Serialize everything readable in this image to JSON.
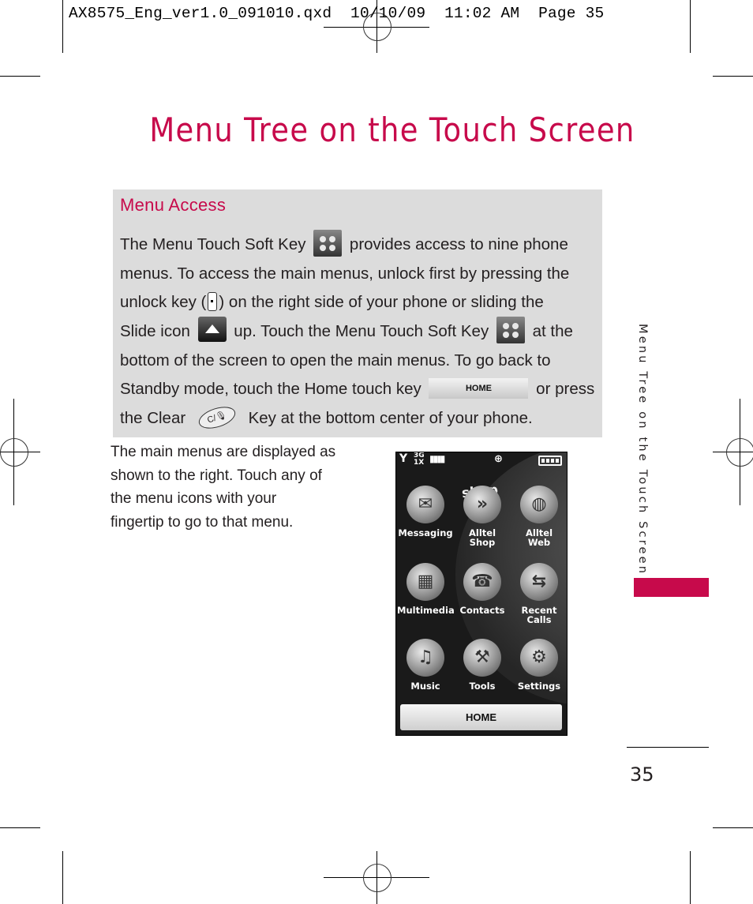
{
  "slug_line": "AX8575_Eng_ver1.0_091010.qxd  10/10/09  11:02 AM  Page 35",
  "page_title": "Menu Tree on the Touch Screen",
  "menu_access": {
    "heading": "Menu Access",
    "lines": [
      {
        "before": "The Menu Touch Soft Key",
        "icon": "menu-soft-key-icon",
        "after": " provides access to nine phone"
      },
      {
        "before": "menus. To access the main menus, unlock first by pressing the",
        "icon": null,
        "after": ""
      },
      {
        "before": "unlock key (",
        "icon": "unlock-key-icon",
        "after": ") on the right side of your phone or sliding the"
      },
      {
        "before": "Slide icon",
        "icon": "slide-icon",
        "after": "up. Touch the Menu Touch Soft Key"
      },
      {
        "before": "bottom of the screen to open the main menus. To go back to",
        "icon": null,
        "after": ""
      },
      {
        "before": "Standby mode, touch the Home touch key",
        "icon": "home-key-icon",
        "after": "or press"
      },
      {
        "before": "the Clear",
        "icon": "clear-key-icon",
        "after": "Key at the bottom center of your phone."
      }
    ],
    "line4_tail": "at the",
    "home_key_label": "HOME",
    "clear_key_label": "C/🎙"
  },
  "side_text": [
    "The main menus are displayed as",
    "shown to the right. Touch any of",
    "the menu icons with your",
    "fingertip to go to that menu."
  ],
  "phone_screen": {
    "status": {
      "signal": "Y",
      "network_top": "3G",
      "network_bottom": "1X",
      "bars": "▮▮▮▮",
      "center_icon": "⊕"
    },
    "shop_banner": "shop",
    "apps": [
      {
        "label": "Messaging",
        "icon": "envelope-icon",
        "glyph": "✉"
      },
      {
        "label": "Alltel\nShop",
        "icon": "shop-arrow-icon",
        "glyph": "»"
      },
      {
        "label": "Alltel\nWeb",
        "icon": "globe-icon",
        "glyph": "◍"
      },
      {
        "label": "Multimedia",
        "icon": "clapperboard-icon",
        "glyph": "▦"
      },
      {
        "label": "Contacts",
        "icon": "contacts-book-icon",
        "glyph": "☎"
      },
      {
        "label": "Recent\nCalls",
        "icon": "recent-calls-icon",
        "glyph": "⇆"
      },
      {
        "label": "Music",
        "icon": "music-note-icon",
        "glyph": "♫"
      },
      {
        "label": "Tools",
        "icon": "toolbox-icon",
        "glyph": "⚒"
      },
      {
        "label": "Settings",
        "icon": "gear-icon",
        "glyph": "⚙"
      }
    ],
    "home_button": "HOME"
  },
  "side_tab_text": "Menu Tree on the Touch Screen",
  "page_number": "35",
  "colors": {
    "accent": "#c70a4b",
    "box_bg": "#dcdcdc"
  }
}
